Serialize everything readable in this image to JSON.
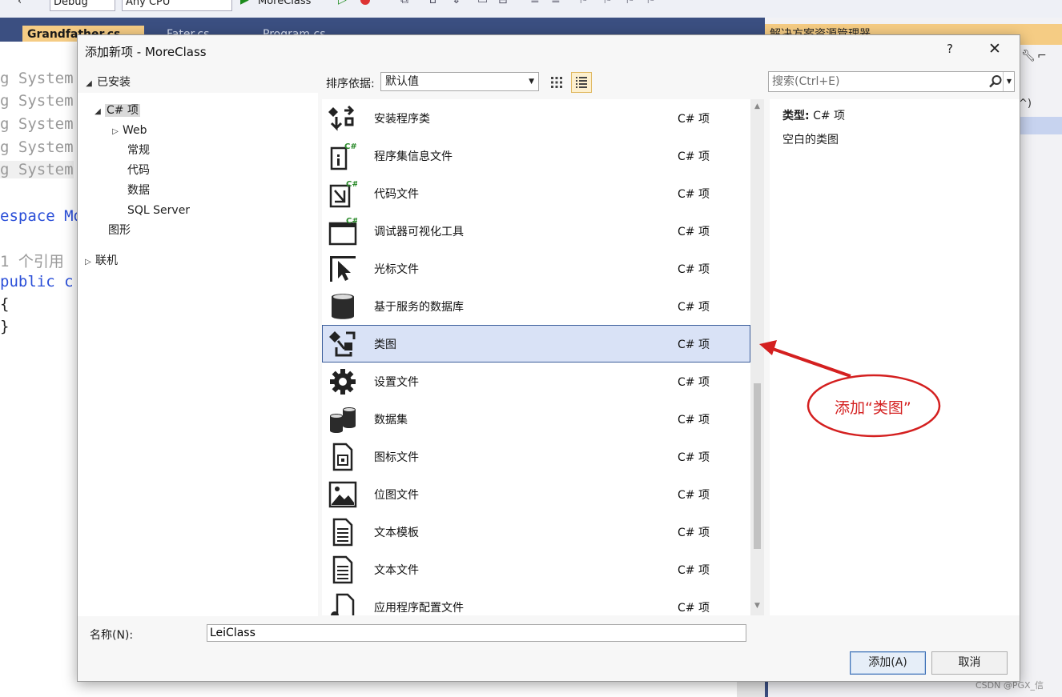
{
  "ide": {
    "toolbar": {
      "config": "Debug",
      "platform": "Any CPU",
      "start_target": "MoreClass"
    },
    "tabs": [
      {
        "label": "Grandfather.cs",
        "active": true
      },
      {
        "label": "Fater.cs",
        "active": false
      },
      {
        "label": "Program.cs",
        "active": false
      }
    ],
    "code": {
      "lines": [
        "g System",
        "g System",
        "g System",
        "g System",
        "g System",
        "espace Mo",
        "1 个引用",
        "public c",
        "{",
        "}"
      ]
    },
    "right_panel": {
      "title": "解决方案资源管理器",
      "partial_glyph": "^)"
    }
  },
  "dialog": {
    "title": "添加新项 - MoreClass",
    "help_label": "?",
    "close_label": "✕",
    "installed_label": "已安装",
    "tree": [
      {
        "label": "C# 项",
        "expanded": true,
        "selected": true
      },
      {
        "label": "Web",
        "expanded": false
      },
      {
        "label": "常规"
      },
      {
        "label": "代码"
      },
      {
        "label": "数据"
      },
      {
        "label": "SQL Server"
      },
      {
        "label": "图形"
      },
      {
        "label": "联机",
        "expanded": false
      }
    ],
    "sort_label": "排序依据:",
    "sort_value": "默认值",
    "search_placeholder": "搜索(Ctrl+E)",
    "items": [
      {
        "name": "安装程序类",
        "type": "C# 项",
        "icon": "installer-class-icon"
      },
      {
        "name": "程序集信息文件",
        "type": "C# 项",
        "icon": "assembly-info-icon"
      },
      {
        "name": "代码文件",
        "type": "C# 项",
        "icon": "code-file-icon"
      },
      {
        "name": "调试器可视化工具",
        "type": "C# 项",
        "icon": "debugger-visualizer-icon"
      },
      {
        "name": "光标文件",
        "type": "C# 项",
        "icon": "cursor-file-icon"
      },
      {
        "name": "基于服务的数据库",
        "type": "C# 项",
        "icon": "database-icon"
      },
      {
        "name": "类图",
        "type": "C# 项",
        "icon": "class-diagram-icon",
        "selected": true
      },
      {
        "name": "设置文件",
        "type": "C# 项",
        "icon": "settings-gear-icon"
      },
      {
        "name": "数据集",
        "type": "C# 项",
        "icon": "dataset-icon"
      },
      {
        "name": "图标文件",
        "type": "C# 项",
        "icon": "icon-file-icon"
      },
      {
        "name": "位图文件",
        "type": "C# 项",
        "icon": "bitmap-file-icon"
      },
      {
        "name": "文本模板",
        "type": "C# 项",
        "icon": "text-template-icon"
      },
      {
        "name": "文本文件",
        "type": "C# 项",
        "icon": "text-file-icon"
      },
      {
        "name": "应用程序配置文件",
        "type": "C# 项",
        "icon": "app-config-icon"
      }
    ],
    "detail": {
      "type_label": "类型:",
      "type_value": "C# 项",
      "description": "空白的类图"
    },
    "name_label": "名称(N):",
    "name_value": "LeiClass",
    "add_label": "添加(A)",
    "cancel_label": "取消"
  },
  "annotation": {
    "text": "添加“类图”",
    "color": "#d42020"
  },
  "watermark": "CSDN @PGX_信",
  "colors": {
    "selection": "#d9e2f6",
    "selection_border": "#3a5c9a",
    "tab_strip": "#3b4f81",
    "active_tab": "#f5cc84",
    "keyword": "#2b4fd8"
  }
}
